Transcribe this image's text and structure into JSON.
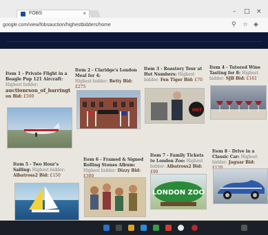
{
  "browser": {
    "tab_title": "FOBS",
    "tab_close": "×",
    "url": "google.com/view/fobsauction/highestbidders/home",
    "back": "←",
    "forward": "→",
    "reload": "⟳",
    "zoom_icon": "search-icon",
    "star_icon": "star-icon"
  },
  "items": [
    {
      "title": "Item 1 - Private Flight in a Beagle Pup 121 Aircraft:",
      "bidder_label": "Highest bidder:",
      "bidder": "auctionrson_of_barringt",
      "bid_prefix": "on Bid:",
      "bid": "£500"
    },
    {
      "title": "Item 2 - Claridge's London Meal for 4:",
      "bidder_label": "Highest bidder:",
      "bidder": "Betty",
      "bid_prefix": "Bid:",
      "bid": "£275"
    },
    {
      "title": "Item 3 - Roastery Tour at Hot Numbers:",
      "bidder_label": "Highest bidder:",
      "bidder": "Fen Tiger",
      "bid_prefix": "Bid:",
      "bid": "£70"
    },
    {
      "title": "Item 4 - Tutored Wine Tasting for 8:",
      "bidder_label": "Highest bidder:",
      "bidder": "SJB",
      "bid_prefix": "Bid:",
      "bid": "£161"
    },
    {
      "title": "Item 5 - Two Hour's Sailing:",
      "bidder_label": "Highest bidder:",
      "bidder": "Albatross2",
      "bid_prefix": "Bid:",
      "bid": "£150"
    },
    {
      "title": "Item 6 - Framed & Signed Rolling Stones Album:",
      "bidder_label": "Highest bidder:",
      "bidder": "Dizzy",
      "bid_prefix": "Bid:",
      "bid": "£300"
    },
    {
      "title": "Item 7 - Family Tickets to London Zoo:",
      "bidder_label": "Highest bidder:",
      "bidder": "Albatross2",
      "bid_prefix": "Bid:",
      "bid": "£90"
    },
    {
      "title": "Item 8 - Drive in a Classic Car:",
      "bidder_label": "Highest bidder:",
      "bidder": "Jaguar",
      "bid_prefix": "Bid:",
      "bid": "£120"
    }
  ],
  "images": {
    "zoo_sign": "LONDON ZOO",
    "hot_sign": "HOT"
  },
  "colors": {
    "header_navy": "#0d1838",
    "bidder_color": "#5a3a2a",
    "bid_color": "#7a2a1a"
  }
}
